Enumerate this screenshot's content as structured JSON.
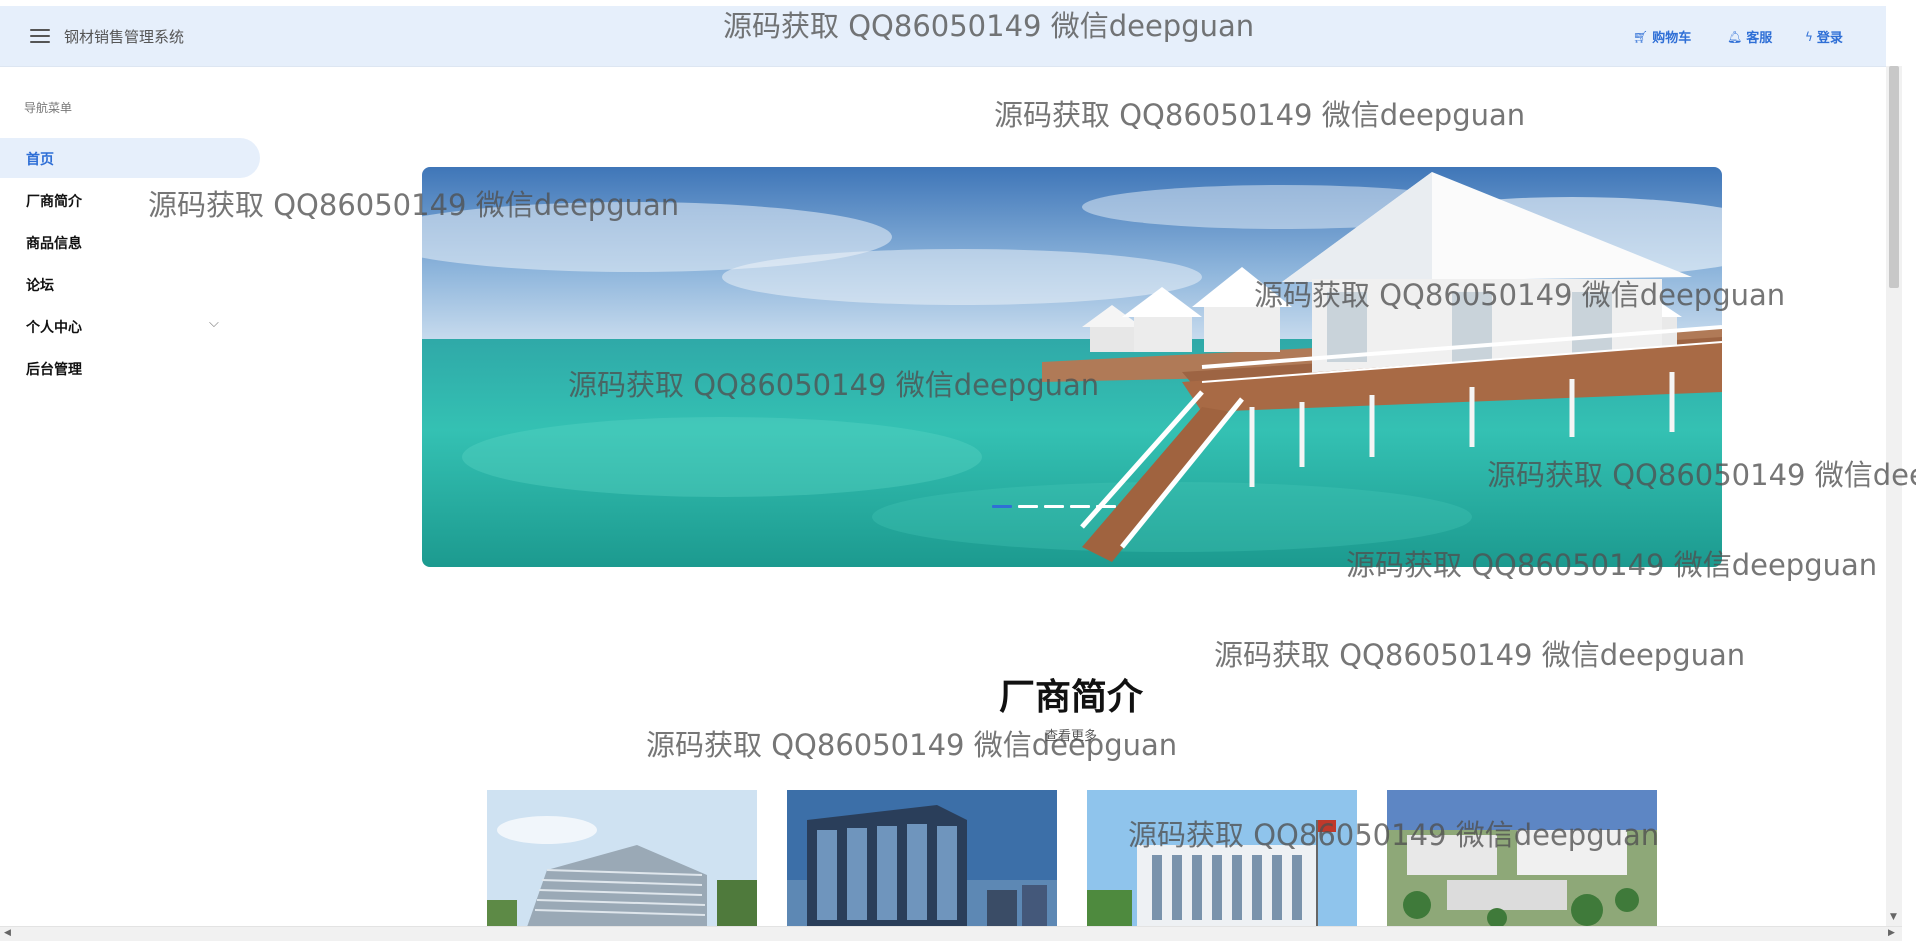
{
  "header": {
    "app_title": "钢材销售管理系统",
    "links": {
      "cart": "购物车",
      "service": "客服",
      "login": "登录"
    }
  },
  "sidebar": {
    "caption": "导航菜单",
    "items": [
      {
        "label": "首页",
        "active": true
      },
      {
        "label": "厂商简介"
      },
      {
        "label": "商品信息"
      },
      {
        "label": "论坛"
      },
      {
        "label": "个人中心",
        "has_submenu": true
      },
      {
        "label": "后台管理"
      }
    ]
  },
  "carousel": {
    "slide_count": 4,
    "active_index": 0
  },
  "section": {
    "title": "厂商简介",
    "more_label": "查看更多"
  },
  "watermark": {
    "text": "源码获取 QQ86050149 微信deepguan"
  },
  "colors": {
    "accent": "#2f6fd6",
    "header_bg": "#e6effb"
  },
  "icons": {
    "menu": "hamburger-icon",
    "cart": "cart-icon",
    "service": "bell-icon",
    "login": "lightning-icon",
    "submenu": "chevron-down-icon"
  }
}
